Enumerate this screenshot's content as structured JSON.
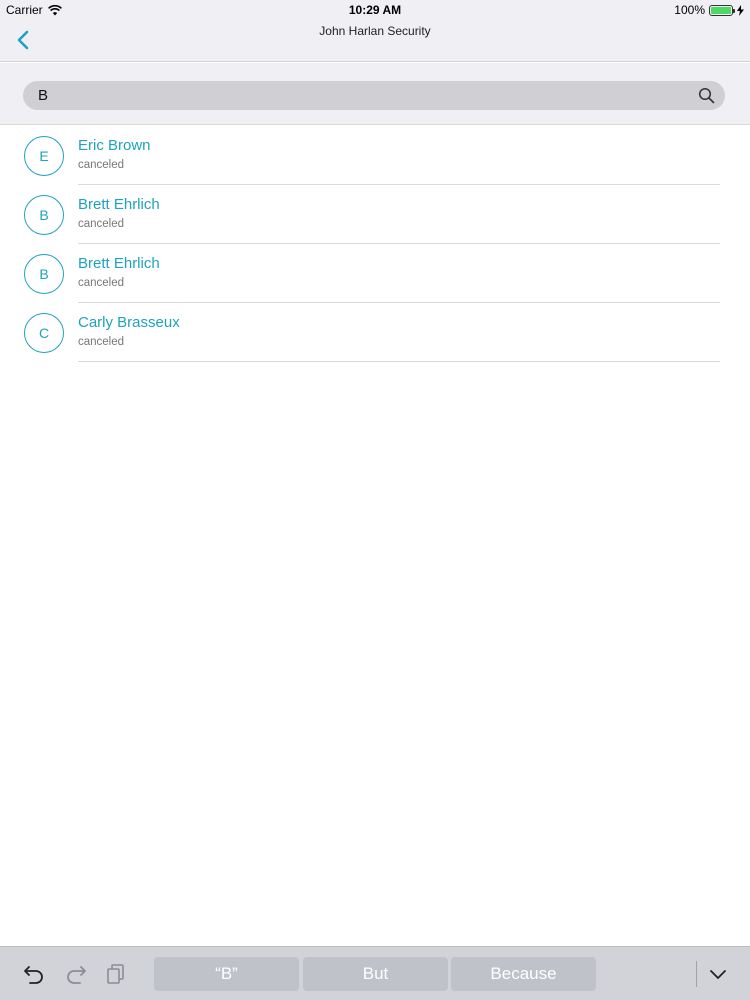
{
  "status_bar": {
    "carrier": "Carrier",
    "time": "10:29 AM",
    "battery": "100%",
    "battery_level": 1.0
  },
  "nav": {
    "title": "John Harlan Security",
    "back_icon": "chevron-left-icon"
  },
  "search": {
    "value": "B",
    "placeholder": "",
    "icon": "search-icon"
  },
  "contacts": [
    {
      "initial": "E",
      "name": "Eric Brown",
      "status": "canceled"
    },
    {
      "initial": "B",
      "name": "Brett Ehrlich",
      "status": "canceled"
    },
    {
      "initial": "B",
      "name": "Brett Ehrlich",
      "status": "canceled"
    },
    {
      "initial": "C",
      "name": "Carly Brasseux",
      "status": "canceled"
    }
  ],
  "keyboard_bar": {
    "suggestions": [
      "“B”",
      "But",
      "Because"
    ]
  },
  "colors": {
    "accent": "#1fa3bd",
    "bar_bg": "#efeff4",
    "keyboard_bg": "#d1d3d9"
  }
}
